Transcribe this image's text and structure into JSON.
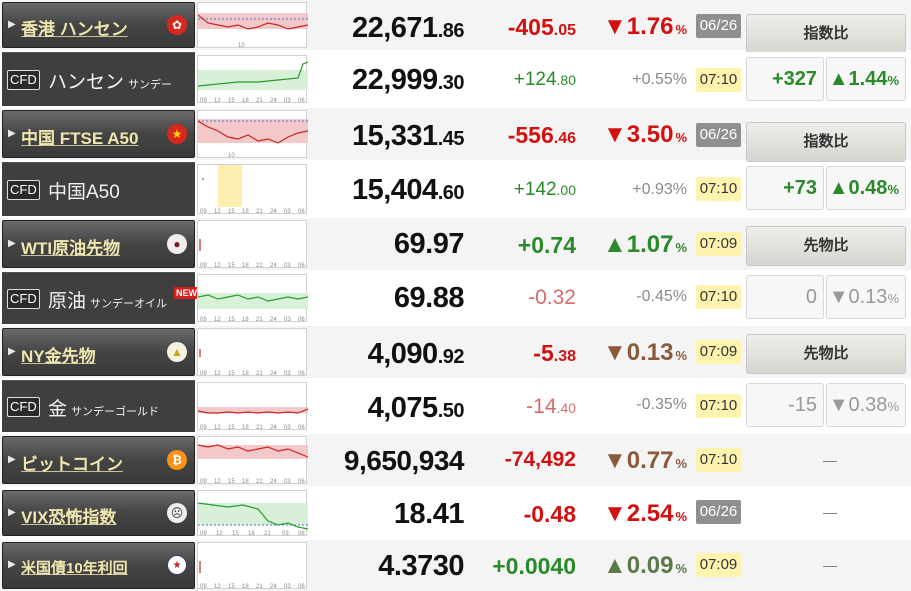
{
  "rows": [
    {
      "name": "香港 ハンセン",
      "price_int": "22,671",
      "price_dec": ".86",
      "chg_int": "-405",
      "chg_dec": ".05",
      "pct": "▼1.76",
      "pct_unit": "%",
      "time": "06/26",
      "cmp_label": "指数比"
    },
    {
      "cfd": "CFD",
      "name": "ハンセン",
      "sub": "サンデー",
      "price_int": "22,999",
      "price_dec": ".30",
      "chg_int": "+124",
      "chg_dec": ".80",
      "pct": "+0.55%",
      "time": "07:10",
      "diff_val": "+327",
      "diff_pct": "▲1.44",
      "diff_unit": "%"
    },
    {
      "name": "中国 FTSE A50",
      "price_int": "15,331",
      "price_dec": ".45",
      "chg_int": "-556",
      "chg_dec": ".46",
      "pct": "▼3.50",
      "pct_unit": "%",
      "time": "06/26",
      "cmp_label": "指数比"
    },
    {
      "cfd": "CFD",
      "name": "中国A50",
      "price_int": "15,404",
      "price_dec": ".60",
      "chg_int": "+142",
      "chg_dec": ".00",
      "pct": "+0.93%",
      "time": "07:10",
      "diff_val": "+73",
      "diff_pct": "▲0.48",
      "diff_unit": "%"
    },
    {
      "name": "WTI原油先物",
      "price_int": "69.97",
      "price_dec": "",
      "chg_int": "+0.74",
      "chg_dec": "",
      "pct": "▲1.07",
      "pct_unit": "%",
      "time": "07:09",
      "cmp_label": "先物比"
    },
    {
      "cfd": "CFD",
      "name": "原油",
      "sub": "サンデーオイル",
      "new": "NEW",
      "price_int": "69.88",
      "price_dec": "",
      "chg_int": "-0.32",
      "chg_dec": "",
      "pct": "-0.45%",
      "time": "07:10",
      "diff_val": "0",
      "diff_pct": "▼0.13",
      "diff_unit": "%"
    },
    {
      "name": "NY金先物",
      "price_int": "4,090",
      "price_dec": ".92",
      "chg_int": "-5",
      "chg_dec": ".38",
      "pct": "▼0.13",
      "pct_unit": "%",
      "time": "07:09",
      "cmp_label": "先物比"
    },
    {
      "cfd": "CFD",
      "name": "金",
      "sub": "サンデーゴールド",
      "price_int": "4,075",
      "price_dec": ".50",
      "chg_int": "-14",
      "chg_dec": ".40",
      "pct": "-0.35%",
      "time": "07:10",
      "diff_val": "-15",
      "diff_pct": "▼0.38",
      "diff_unit": "%"
    },
    {
      "name": "ビットコイン",
      "price_int": "9,650,934",
      "price_dec": "",
      "chg_int": "-74,492",
      "chg_dec": "",
      "pct": "▼0.77",
      "pct_unit": "%",
      "time": "07:10",
      "dash": "—"
    },
    {
      "name": "VIX恐怖指数",
      "price_int": "18.41",
      "price_dec": "",
      "chg_int": "-0.48",
      "chg_dec": "",
      "pct": "▼2.54",
      "pct_unit": "%",
      "time": "06/26",
      "dash": "—"
    },
    {
      "name": "米国債10年利回",
      "price_int": "4.3730",
      "price_dec": "",
      "chg_int": "+0.0040",
      "chg_dec": "",
      "pct": "▲0.09",
      "pct_unit": "%",
      "time": "07:09",
      "dash": "—"
    }
  ],
  "chart_ticks": [
    "09",
    "12",
    "15",
    "18",
    "21",
    "24",
    "03",
    "06"
  ],
  "chart_ticks_vix": [
    "09",
    "12",
    "15",
    "18",
    "21",
    "03",
    "06"
  ],
  "chart_ticks_hk": [
    "10"
  ]
}
